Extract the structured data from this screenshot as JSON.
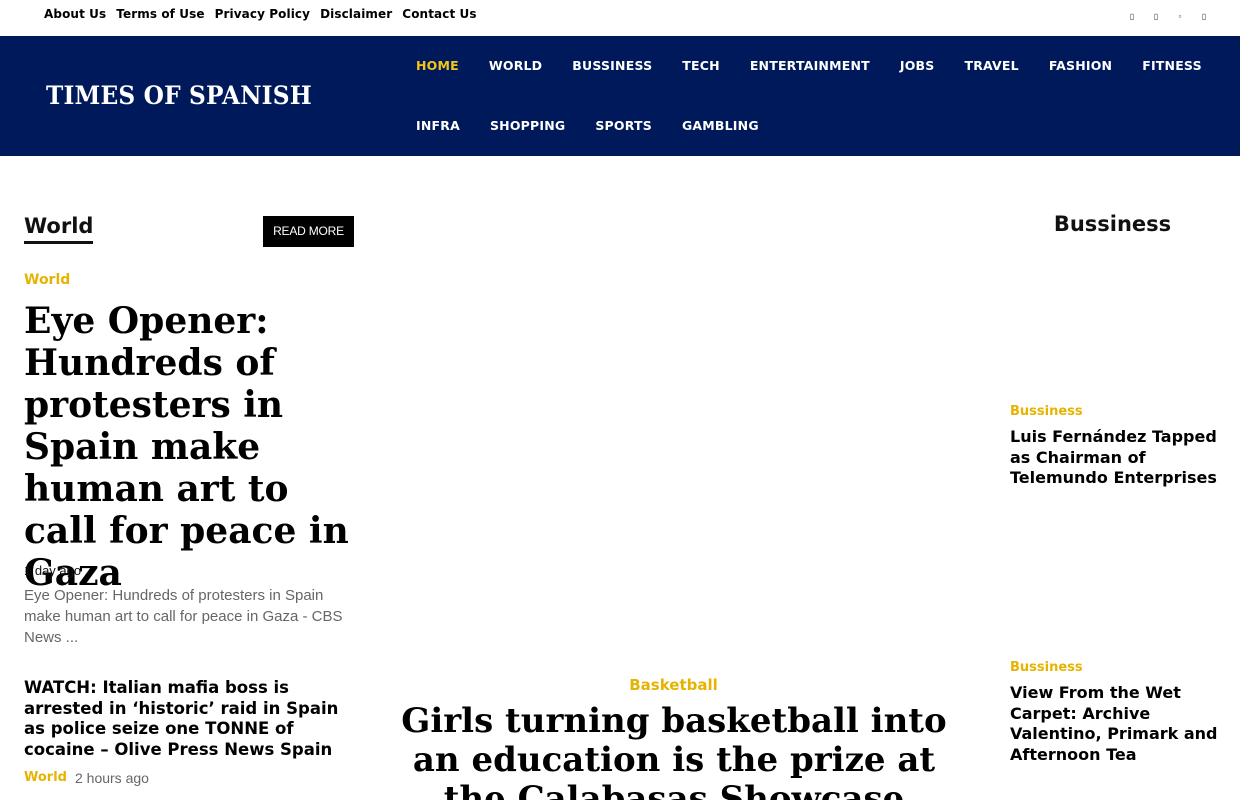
{
  "topbar": {
    "links": [
      "About Us",
      "Terms of Use",
      "Privacy Policy",
      "Disclaimer",
      "Contact Us"
    ],
    "social_icons": [
      "facebook-icon",
      "instagram-icon",
      "twitter-icon",
      "youtube-icon"
    ]
  },
  "header": {
    "logo": "TIMES OF SPANISH",
    "nav_row1": [
      "HOME",
      "WORLD",
      "BUSSINESS",
      "TECH",
      "ENTERTAINMENT",
      "JOBS",
      "TRAVEL",
      "FASHION",
      "FITNESS"
    ],
    "nav_row2": [
      "INFRA",
      "SHOPPING",
      "SPORTS",
      "GAMBLING"
    ],
    "active": "HOME"
  },
  "left": {
    "section_title": "World",
    "read_more": "READ MORE",
    "featured": {
      "category": "World",
      "title": "Eye Opener: Hundreds of protesters in Spain make human art to call for peace in Gaza",
      "time": "1 day ago",
      "excerpt": "Eye Opener: Hundreds of protesters in Spain make human art to call for peace in Gaza - CBS News ..."
    },
    "item": {
      "title": "WATCH: Italian mafia boss is arrested in ‘historic’ raid in Spain as police seize one TONNE of cocaine – Olive Press News Spain",
      "category": "World",
      "time": "2 hours ago"
    }
  },
  "middle": {
    "category": "Basketball",
    "title": "Girls turning basketball into an education is the prize at the Calabasas Showcase"
  },
  "right": {
    "section_title": "Bussiness",
    "items": [
      {
        "category": "Bussiness",
        "title": "Luis Fernández Tapped as Chairman of Telemundo Enterprises"
      },
      {
        "category": "Bussiness",
        "title": "View From the Wet Carpet: Archive Valentino, Primark and Afternoon Tea"
      }
    ]
  },
  "colors": {
    "header_bg": "#00195a",
    "accent": "#f5c518",
    "category": "#e6b400"
  }
}
